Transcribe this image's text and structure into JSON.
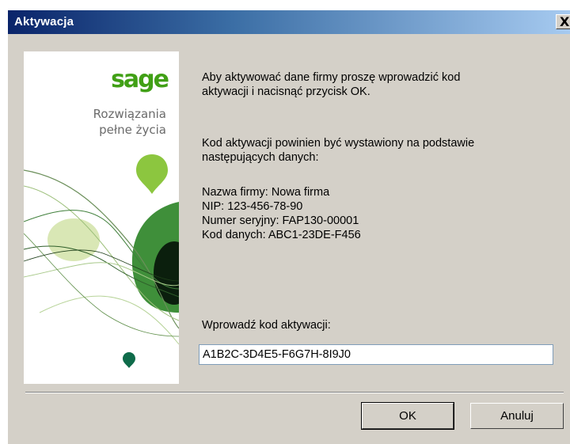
{
  "window": {
    "title": "Aktywacja",
    "close_glyph": "X"
  },
  "side_panel": {
    "brand": "sage",
    "tagline_line1": "Rozwiązania",
    "tagline_line2": "pełne życia",
    "accent_colors": [
      "#41a016",
      "#8cc63f",
      "#2e7d32",
      "#0b1f0d"
    ]
  },
  "messages": {
    "intro_line1": "Aby aktywować dane firmy proszę wprowadzić kod",
    "intro_line2": "aktywacji i nacisnąć przycisk OK.",
    "basis_line1": "Kod aktywacji powinien być wystawiony na podstawie",
    "basis_line2": "następujących danych:",
    "company": "Nazwa firmy: Nowa firma",
    "nip": "NIP: 123-456-78-90",
    "serial": "Numer seryjny: FAP130-00001",
    "data_code": "Kod danych: ABC1-23DE-F456"
  },
  "activation": {
    "label": "Wprowadź kod aktywacji:",
    "value": "A1B2C-3D4E5-F6G7H-8I9J0"
  },
  "buttons": {
    "ok": "OK",
    "cancel": "Anuluj"
  }
}
